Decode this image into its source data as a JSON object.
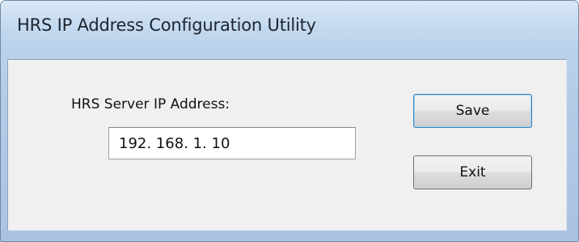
{
  "window": {
    "title": "HRS IP Address Configuration Utility"
  },
  "form": {
    "ip_label": "HRS Server IP Address:",
    "ip_value": "192. 168. 1. 10"
  },
  "buttons": {
    "save_label": "Save",
    "exit_label": "Exit"
  },
  "colors": {
    "titlebar": "#c6dbf0",
    "frame": "#a9c3e0",
    "client_background": "#f0f0f0",
    "default_button_border": "#3c7fb1"
  }
}
